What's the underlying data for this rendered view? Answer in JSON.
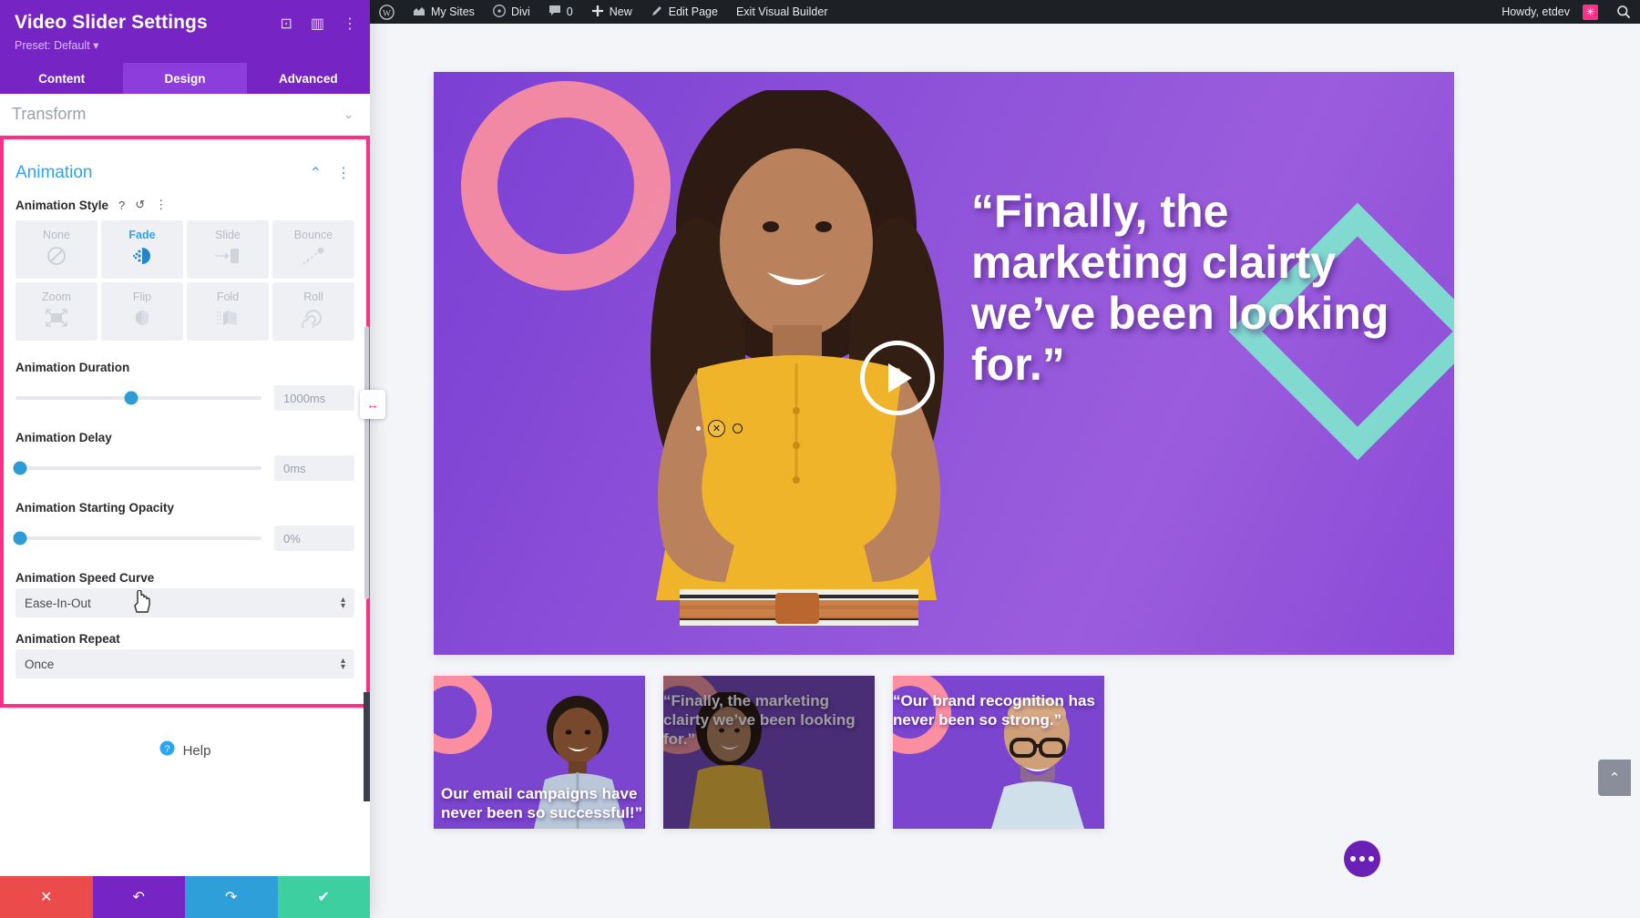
{
  "panel": {
    "title": "Video Slider Settings",
    "preset": "Preset: Default",
    "preset_caret": "▾",
    "head_icons": [
      {
        "name": "focus-icon",
        "glyph": "⊡"
      },
      {
        "name": "layout-icon",
        "glyph": "▥"
      },
      {
        "name": "more-vertical-icon",
        "glyph": "⋮"
      }
    ],
    "tabs": [
      {
        "label": "Content",
        "active": false
      },
      {
        "label": "Design",
        "active": true
      },
      {
        "label": "Advanced",
        "active": false
      }
    ],
    "transform": {
      "label": "Transform",
      "chevron": "⌄"
    },
    "animation": {
      "title": "Animation",
      "collapse_icon": "⌃",
      "options_icon": "⋮",
      "style_label": "Animation Style",
      "help_icon": "?",
      "reset_icon": "↺",
      "more_icon": "⋮",
      "styles": [
        {
          "name": "None",
          "selected": false,
          "icon": "no-entry-icon"
        },
        {
          "name": "Fade",
          "selected": true,
          "icon": "fade-icon"
        },
        {
          "name": "Slide",
          "selected": false,
          "icon": "slide-icon"
        },
        {
          "name": "Bounce",
          "selected": false,
          "icon": "bounce-icon"
        },
        {
          "name": "Zoom",
          "selected": false,
          "icon": "zoom-icon"
        },
        {
          "name": "Flip",
          "selected": false,
          "icon": "flip-icon"
        },
        {
          "name": "Fold",
          "selected": false,
          "icon": "fold-icon"
        },
        {
          "name": "Roll",
          "selected": false,
          "icon": "roll-icon"
        }
      ],
      "duration": {
        "label": "Animation Duration",
        "value": "1000ms",
        "percent": 47
      },
      "delay": {
        "label": "Animation Delay",
        "value": "0ms",
        "percent": 0
      },
      "opacity": {
        "label": "Animation Starting Opacity",
        "value": "0%",
        "percent": 0
      },
      "speed_curve": {
        "label": "Animation Speed Curve",
        "value": "Ease-In-Out",
        "arrows": "⇅"
      },
      "repeat": {
        "label": "Animation Repeat",
        "value": "Once",
        "arrows": "⇅"
      }
    },
    "help": {
      "label": "Help",
      "icon": "question-circle-icon"
    },
    "footer": [
      {
        "name": "close-button",
        "glyph": "✕"
      },
      {
        "name": "undo-button",
        "glyph": "↶"
      },
      {
        "name": "redo-button",
        "glyph": "↷"
      },
      {
        "name": "save-button",
        "glyph": "✔"
      }
    ]
  },
  "adminbar": {
    "wp_logo": "Ⓦ",
    "items": [
      {
        "label": "My Sites",
        "icon": "sites-icon"
      },
      {
        "label": "Divi",
        "icon": "divi-icon"
      },
      {
        "label": "0",
        "icon": "comment-icon"
      },
      {
        "label": "New",
        "icon": "plus-icon"
      },
      {
        "label": "Edit Page",
        "icon": "pencil-icon"
      },
      {
        "label": "Exit Visual Builder",
        "icon": ""
      }
    ],
    "howdy": "Howdy, etdev",
    "avatar_glyph": "✳",
    "search_icon": "search-icon"
  },
  "canvas": {
    "hero": {
      "quote": "“Finally, the marketing clairty we’ve been looking for.”",
      "play_label": "play-button"
    },
    "thumbnails": [
      {
        "text": "Our email campaigns have never been so successful!”",
        "active": false
      },
      {
        "text": "“Finally, the marketing clairty we’ve been looking for.”",
        "active": true
      },
      {
        "text": "“Our brand recognition has never been so strong.”",
        "active": false
      }
    ],
    "more_button": "more-options-button",
    "scroll_top": "⌃"
  },
  "colors": {
    "brand_purple": "#7625c4",
    "tab_active": "#8d3ddb",
    "accent_blue": "#2ea3f2",
    "highlight_pink": "#ff2e87",
    "slider_blue": "#2c9bd6",
    "teal": "#7fe0cf",
    "coral": "#fb8fa0"
  }
}
